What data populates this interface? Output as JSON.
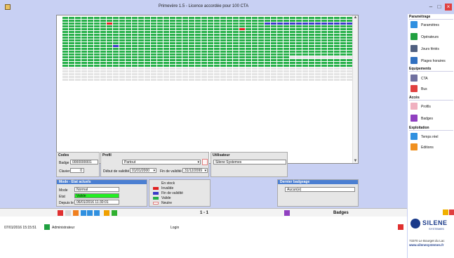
{
  "window": {
    "title": "Primevère 1.5 - Licence accordée pour 100 CTA",
    "minimize": "–",
    "maximize": "□",
    "close": "×"
  },
  "grid": {
    "rows": [
      "gggggggggggggggggggggggggggggggggggggggggggggg",
      "gggggggggggggggggggggggggggggggggggggggggggggg",
      "gggggggrggggggggggggggggggggggggbbbbbbbbbbbbbb",
      "gggggggggggggggggggggggggggggggggggggggggggggg",
      "ggggggggggggggggggggggggggggrggggggggggggggggg",
      "gggggggggggggggggggggggggggggggggggggggggggggg",
      "gggggggggggggggggggggggggggggggggggggggggggggg",
      "gggggggggggggggggggggggggggggggggggggggggggggg",
      "gggggggggggggggggggggggggggggggggggggggggggggg",
      "gggggggggggggggggggggggggggggggggggggggggggggg",
      "ggggggggbggggggggggggggggggggggggggggggggggggg",
      "gggggggggggggggggggggggggggggggggggggggggggggg",
      "gggggggggggggggggggggggggggggggggggggggggggggg",
      "gggggggggggggggggggggggggggggggggggggggggggggg",
      "ggggggggggggggggggggggggggggggggggggkkkkkkkkkk",
      "gggggggggggggggggggggggggggggggggggggggggggggg",
      "gggggggggggggggggggggggggggggggggggggggggggggg",
      "gggggggggggggggggggggggggggggggggggggggggggggg",
      "kkkkkkkkkkkkkkkkkkkkkkkkkkkkkkkkkkkkkkkkkkkkkk",
      "kkkkkkkkkkkkkkkkkkkkkkkkkkkkkkkkkkkkkkkkkkkkkk",
      "kkkkkkkkkkkkkkkkkkkkkkkkkkkkkkkkkkkkkkkkkkkkkk",
      "kkkkkkkkkkkkkkkkkkkkkkkkkkkkkkkkkkkkkkkkkkkkkk",
      "kkkkkkkkkkkkkkkkkkkkkkkkkkkkkkkkkkkkkkkkkkkkkk"
    ],
    "colors": {
      "g": "#27b04a",
      "r": "#e02020",
      "b": "#3a3ac8",
      "k": "#e4e4e4"
    }
  },
  "codes": {
    "title": "Codes",
    "badge_label": "Badge",
    "badge_value": "0000000001",
    "clavier_label": "Clavier",
    "clavier_value": "0"
  },
  "profil": {
    "title": "Profil",
    "value": "Partout",
    "debut_label": "Début de validité",
    "debut_value": "01/01/2000",
    "fin_label": "Fin de validité",
    "fin_value": "31/12/2099"
  },
  "utilisateur": {
    "title": "Utilisateur",
    "value": "Silene Systemes"
  },
  "mode": {
    "title": "Mode - Etat actuels",
    "mode_label": "Mode",
    "mode_value": "Normal",
    "etat_label": "Etat",
    "etat_value": "Valide",
    "depuis_label": "Depuis le",
    "depuis_value": "06/01/2016 11:30:01"
  },
  "legend": {
    "items": [
      {
        "label": "En stock",
        "color": "#e4e4e4"
      },
      {
        "label": "Invalide",
        "color": "#e02020"
      },
      {
        "label": "Fin de validité",
        "color": "#3a3ac8"
      },
      {
        "label": "Valide",
        "color": "#27b04a"
      },
      {
        "label": "Neutre",
        "color": "#ffffff"
      }
    ]
  },
  "dernier": {
    "title": "Dernier badgeage",
    "value": "Aucun(e)"
  },
  "status": {
    "page": "1 - 1",
    "section": "Badges",
    "toolbar_colors": [
      "#e03030",
      "#d8d8d8",
      "#f08020",
      "#3090e0",
      "#3090e0",
      "#3090e0",
      "#f0a000",
      "#30b030"
    ]
  },
  "bottom": {
    "datetime": "07/01/2016 15:15:51",
    "user": "Administrateur",
    "login": "Login"
  },
  "sidebar": {
    "sections": [
      {
        "label": "Paramétrage",
        "items": [
          {
            "label": "Paramètres",
            "icon": "settings-icon",
            "color": "#3090e0"
          },
          {
            "label": "Opérateurs",
            "icon": "user-icon",
            "color": "#20a040"
          },
          {
            "label": "Jours fériés",
            "icon": "calendar-icon",
            "color": "#506080"
          },
          {
            "label": "Plages horaires",
            "icon": "clock-icon",
            "color": "#3070c0"
          }
        ]
      },
      {
        "label": "Equipements",
        "items": [
          {
            "label": "CTA",
            "icon": "cta-icon",
            "color": "#7070a0"
          },
          {
            "label": "Bus",
            "icon": "bus-icon",
            "color": "#e04040"
          }
        ]
      },
      {
        "label": "Accès",
        "items": [
          {
            "label": "Profils",
            "icon": "profile-icon",
            "color": "#f0b0c0"
          },
          {
            "label": "Badges",
            "icon": "badge-icon",
            "color": "#9040c0"
          }
        ]
      },
      {
        "label": "Exploitation",
        "items": [
          {
            "label": "Temps réel",
            "icon": "realtime-icon",
            "color": "#3090e0"
          },
          {
            "label": "Editions",
            "icon": "print-icon",
            "color": "#f09020"
          }
        ]
      }
    ],
    "logo_text": "SILENE",
    "logo_sub": "SYSTEMES",
    "address": "73370 Le Bourget du Lac",
    "website": "www.silenesystemes.fr"
  }
}
